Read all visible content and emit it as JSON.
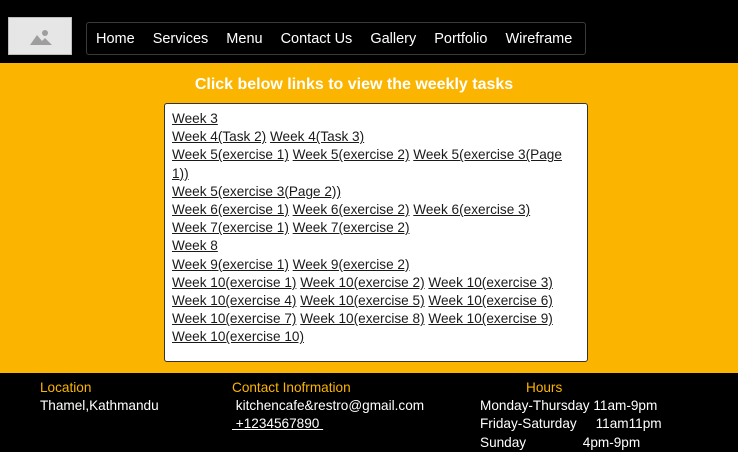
{
  "nav": {
    "items": [
      "Home",
      "Services",
      "Menu",
      "Contact Us",
      "Gallery",
      "Portfolio",
      "Wireframe"
    ]
  },
  "main": {
    "heading": "Click below links to view the weekly tasks",
    "rows": [
      [
        "Week 3"
      ],
      [
        "Week 4(Task 2)",
        "Week 4(Task 3)"
      ],
      [
        "Week 5(exercise 1)",
        "Week 5(exercise 2)",
        "Week 5(exercise 3(Page 1))",
        "Week 5(exercise 3(Page 2))"
      ],
      [
        "Week 6(exercise 1)",
        "Week 6(exercise 2)",
        "Week 6(exercise 3)"
      ],
      [
        "Week 7(exercise 1)",
        "Week 7(exercise 2)"
      ],
      [
        "Week 8"
      ],
      [
        "Week 9(exercise 1)",
        "Week 9(exercise 2)"
      ],
      [
        "Week 10(exercise 1)",
        "Week 10(exercise 2)",
        "Week 10(exercise 3)",
        "Week 10(exercise 4)",
        "Week 10(exercise 5)",
        "Week 10(exercise 6)",
        "Week 10(exercise 7)",
        "Week 10(exercise 8)",
        "Week 10(exercise 9)",
        "Week 10(exercise 10)"
      ]
    ]
  },
  "footer": {
    "location": {
      "title": "Location",
      "text": "Thamel,Kathmandu"
    },
    "contact": {
      "title": "Contact Inofrmation",
      "email": " kitchencafe&restro@gmail.com",
      "phone": " +1234567890 "
    },
    "hours": {
      "title": "Hours",
      "lines": [
        "Monday-Thursday 11am-9pm",
        "Friday-Saturday     11am11pm",
        "Sunday               4pm-9pm"
      ]
    }
  },
  "colors": {
    "accent": "#fbb400",
    "background": "#000000"
  },
  "icons": {
    "logo": "image-placeholder-icon"
  }
}
